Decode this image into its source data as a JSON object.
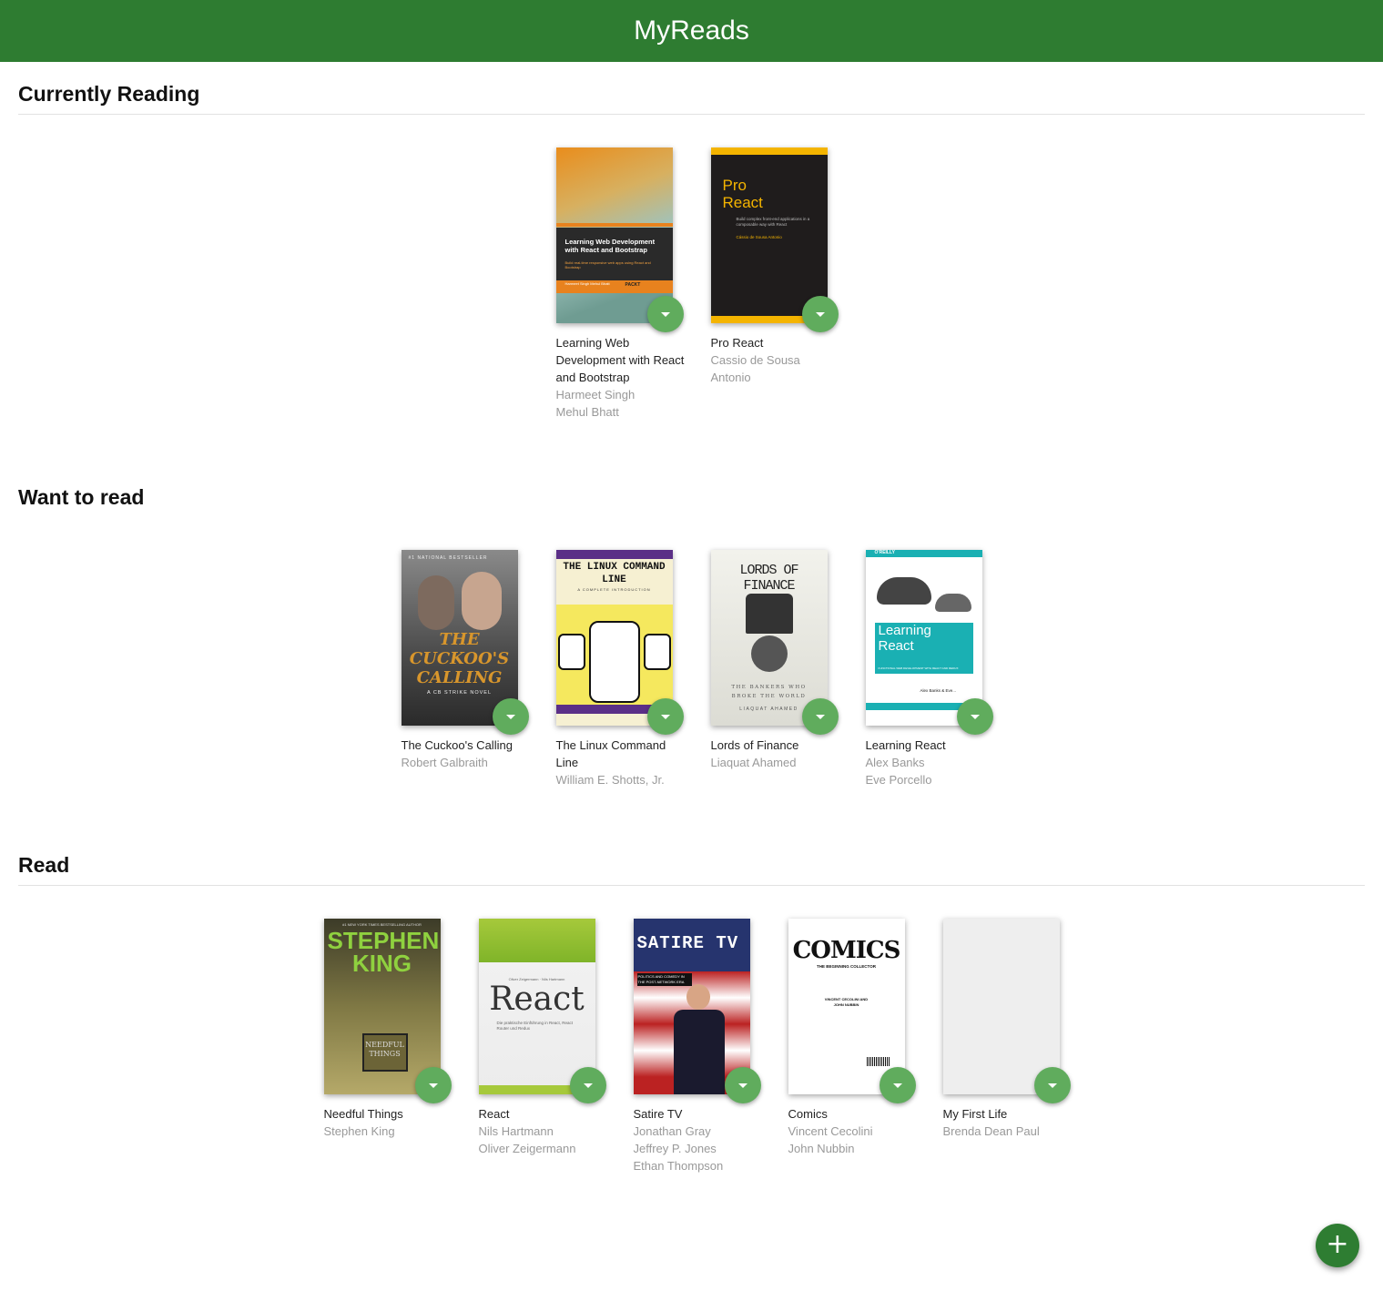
{
  "app": {
    "title": "MyReads"
  },
  "shelves": [
    {
      "title": "Currently Reading",
      "books": [
        {
          "title": "Learning Web Development with React and Bootstrap",
          "authors": [
            "Harmeet Singh",
            "Mehul Bhatt"
          ],
          "cover_text": {
            "headline": "Learning Web Development with React and Bootstrap",
            "sub": "Build real-time responsive web apps using React and Bootstrap",
            "authors": "Harmeet Singh Mehul Bhatt",
            "publisher": "PACKT"
          }
        },
        {
          "title": "Pro React",
          "authors": [
            "Cassio de Sousa Antonio"
          ],
          "cover_text": {
            "headline": "Pro React",
            "sub": "Build complex front-end applications in a composable way with React",
            "authors": "Cássio de Sousa Antonio"
          }
        }
      ]
    },
    {
      "title": "Want to read",
      "books": [
        {
          "title": "The Cuckoo's Calling",
          "authors": [
            "Robert Galbraith"
          ],
          "cover_text": {
            "top": "#1 NATIONAL BESTSELLER",
            "headline": "THE CUCKOO'S CALLING",
            "sub": "A CB STRIKE NOVEL"
          }
        },
        {
          "title": "The Linux Command Line",
          "authors": [
            "William E. Shotts, Jr."
          ],
          "cover_text": {
            "headline": "THE LINUX COMMAND LINE",
            "sub": "A COMPLETE INTRODUCTION",
            "authors": "WILLIAM E. SHOTTS, JR."
          }
        },
        {
          "title": "Lords of Finance",
          "authors": [
            "Liaquat Ahamed"
          ],
          "cover_text": {
            "headline": "LORDS OF FINANCE",
            "sub": "THE BANKERS WHO BROKE THE WORLD",
            "authors": "LIAQUAT AHAMED"
          }
        },
        {
          "title": "Learning React",
          "authors": [
            "Alex Banks",
            "Eve Porcello"
          ],
          "cover_text": {
            "top": "O'REILLY",
            "headline": "Learning React",
            "sub": "FUNCTIONAL WEB DEVELOPMENT WITH REACT AND REDUX",
            "authors": "Alex Banks & Eve..."
          }
        }
      ]
    },
    {
      "title": "Read",
      "books": [
        {
          "title": "Needful Things",
          "authors": [
            "Stephen King"
          ],
          "cover_text": {
            "top": "#1 NEW YORK TIMES BESTSELLING AUTHOR",
            "headline": "STEPHEN KING",
            "sub": "NEEDFUL THINGS"
          }
        },
        {
          "title": "React",
          "authors": [
            "Nils Hartmann",
            "Oliver Zeigermann"
          ],
          "cover_text": {
            "authors": "Oliver Zeigermann · Nils Hartmann",
            "headline": "React",
            "sub": "Die praktische Einführung in React, React Router und Redux"
          }
        },
        {
          "title": "Satire TV",
          "authors": [
            "Jonathan Gray",
            "Jeffrey P. Jones",
            "Ethan Thompson"
          ],
          "cover_text": {
            "headline": "SATIRE TV",
            "sub": "POLITICS AND COMEDY IN THE POST-NETWORK ERA"
          }
        },
        {
          "title": "Comics",
          "authors": [
            "Vincent Cecolini",
            "John Nubbin"
          ],
          "cover_text": {
            "headline": "COMICS",
            "sub": "THE BEGINNING COLLECTOR",
            "authors": "VINCENT CECOLINI AND JOHN NUBBIN"
          }
        },
        {
          "title": "My First Life",
          "authors": [
            "Brenda Dean Paul"
          ],
          "cover_text": {}
        }
      ]
    }
  ],
  "icons": {
    "shelf_changer": "triangle-down-icon",
    "add_book": "plus-icon"
  },
  "colors": {
    "header": "#2e7c31",
    "changer": "#60ac5d",
    "fab": "#2e7d32"
  }
}
